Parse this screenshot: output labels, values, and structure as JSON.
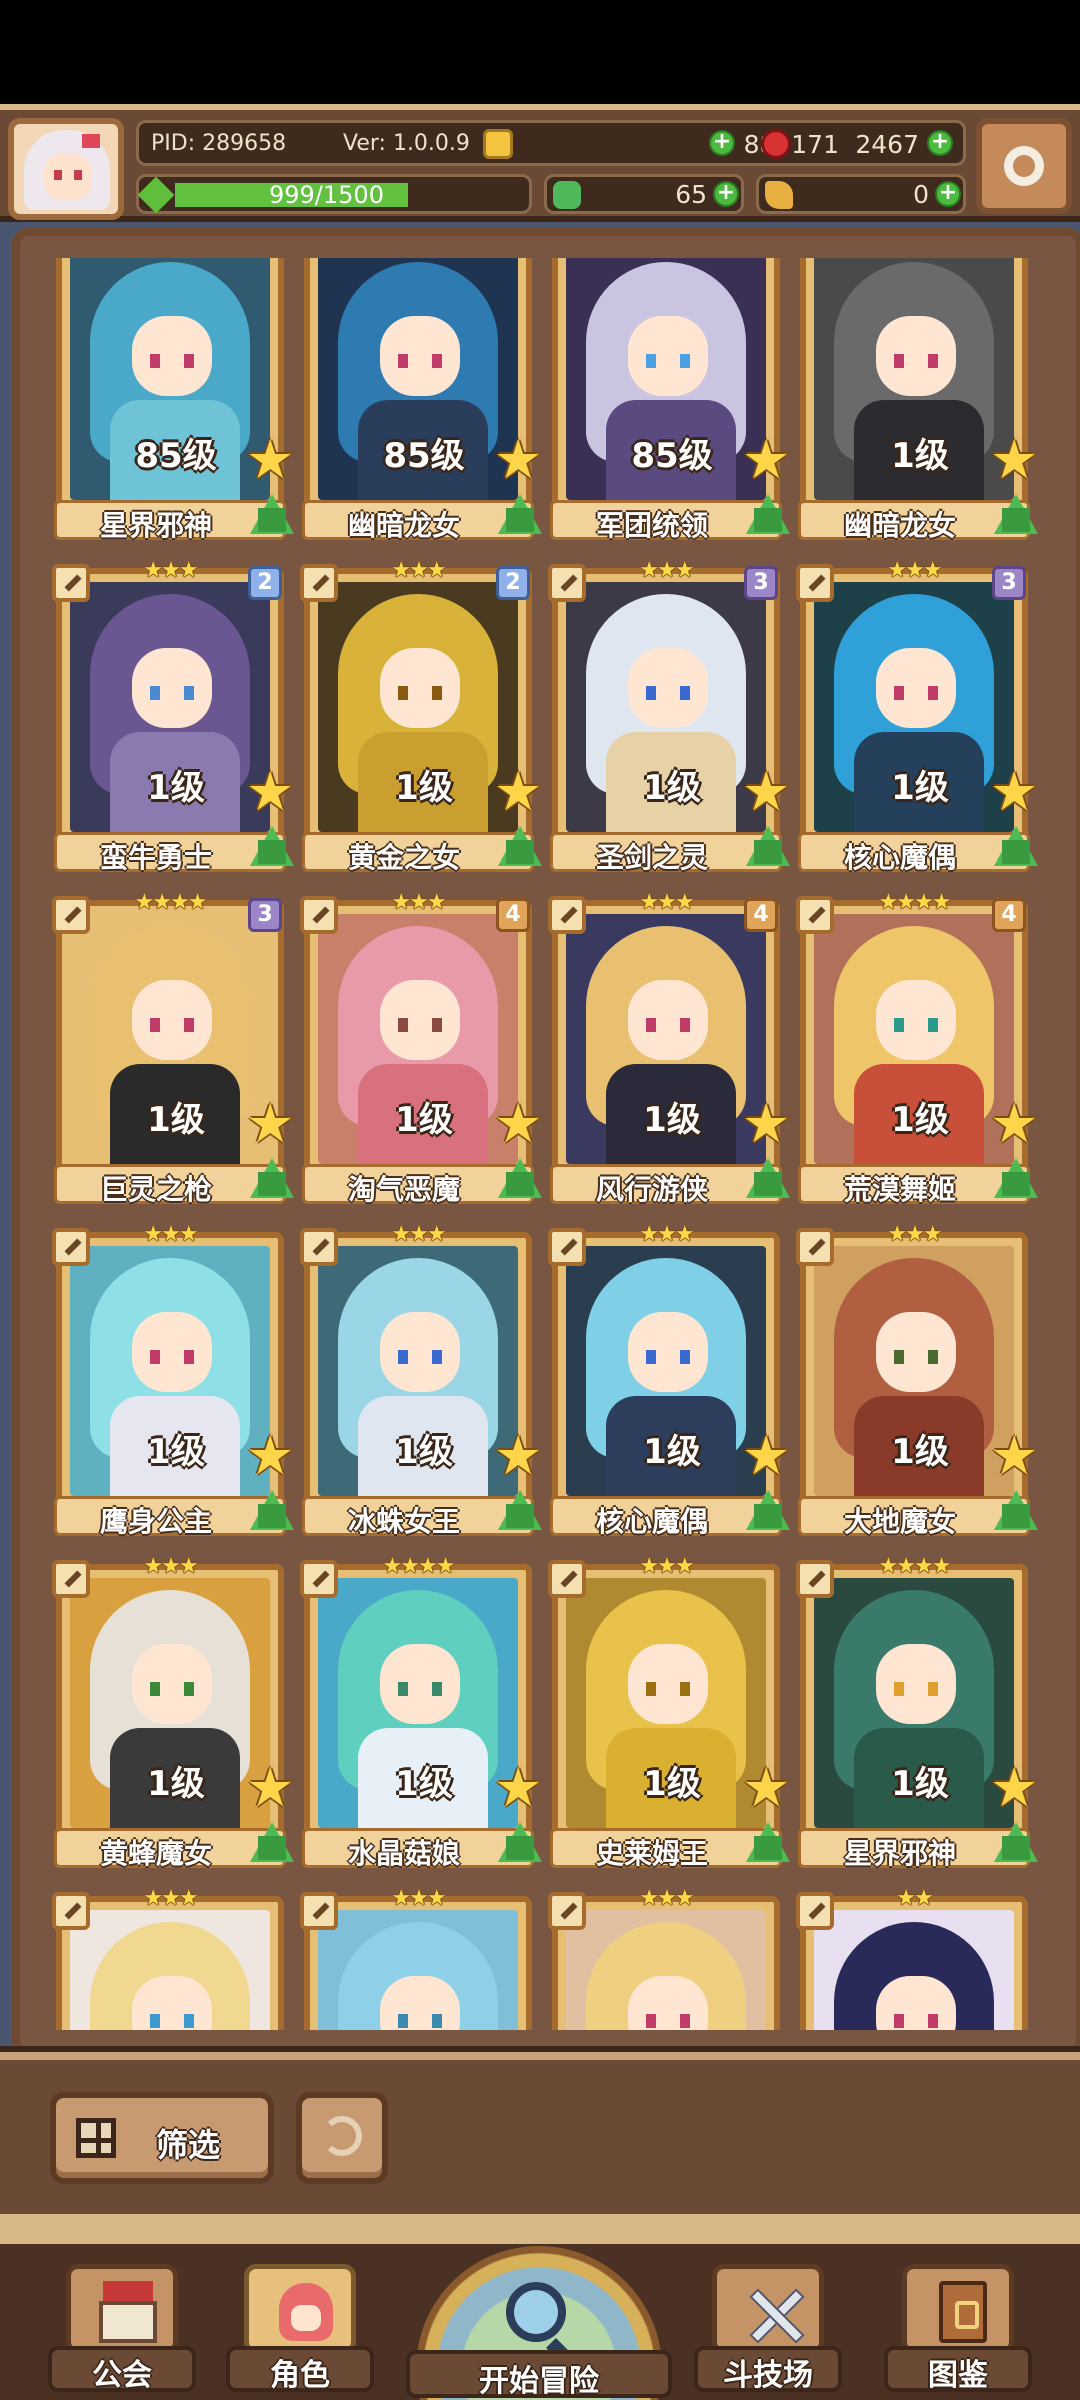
{
  "header": {
    "pid": "PID: 289658",
    "version": "Ver: 1.0.0.9",
    "gold": "886171",
    "gems": "2467",
    "exp_text": "999/1500",
    "exp_progress": 0.666,
    "clover": "65",
    "keys": "0"
  },
  "cards": [
    {
      "name": "星界邪神",
      "level": "85级",
      "stars": "",
      "rank": "",
      "hair": "#4aa9c8",
      "body": "#6fc3d6",
      "eye": "#c23c6a",
      "bg": "#2f5a70"
    },
    {
      "name": "幽暗龙女",
      "level": "85级",
      "stars": "",
      "rank": "",
      "hair": "#2d7bb0",
      "body": "#2a3e5c",
      "eye": "#c23c6a",
      "bg": "#1f3450"
    },
    {
      "name": "军团统领",
      "level": "85级",
      "stars": "",
      "rank": "",
      "hair": "#c9c4e0",
      "body": "#5b4a80",
      "eye": "#4aa0e0",
      "bg": "#3a2f55"
    },
    {
      "name": "幽暗龙女",
      "level": "1级",
      "stars": "",
      "rank": "",
      "hair": "#6a6a6a",
      "body": "#2c2c30",
      "eye": "#c23c6a",
      "bg": "#4a4a4a"
    },
    {
      "name": "蛮牛勇士",
      "level": "1级",
      "stars": "★★★",
      "rank": "2",
      "rank_class": "",
      "hair": "#6a5690",
      "body": "#8a7ab0",
      "eye": "#4a8ad0",
      "bg": "#3a3a5a"
    },
    {
      "name": "黄金之女",
      "level": "1级",
      "stars": "★★★",
      "rank": "2",
      "rank_class": "",
      "hair": "#d9b23a",
      "body": "#c9a030",
      "eye": "#8a5a10",
      "bg": "#4a3a20"
    },
    {
      "name": "圣剑之灵",
      "level": "1级",
      "stars": "★★★",
      "rank": "3",
      "rank_class": "r3",
      "hair": "#dfe6f0",
      "body": "#e6d2a6",
      "eye": "#3a6ad0",
      "bg": "#3c3a46"
    },
    {
      "name": "核心魔偶",
      "level": "1级",
      "stars": "★★★",
      "rank": "3",
      "rank_class": "r3",
      "hair": "#2fa0d8",
      "body": "#24405a",
      "eye": "#c23c6a",
      "bg": "#1e4048"
    },
    {
      "name": "巨灵之枪",
      "level": "1级",
      "stars": "★★★★",
      "rank": "3",
      "rank_class": "r3",
      "hair": "#e8c070",
      "body": "#2a2a2a",
      "eye": "#c23c6a",
      "bg": "#e7bf74"
    },
    {
      "name": "淘气恶魔",
      "level": "1级",
      "stars": "★★★",
      "rank": "4",
      "rank_class": "r4",
      "hair": "#e89aa8",
      "body": "#d9707e",
      "eye": "#8a4a40",
      "bg": "#c8806a"
    },
    {
      "name": "风行游侠",
      "level": "1级",
      "stars": "★★★",
      "rank": "4",
      "rank_class": "r4",
      "hair": "#e8c070",
      "body": "#2a2a3a",
      "eye": "#c23c6a",
      "bg": "#3a3a60"
    },
    {
      "name": "荒漠舞姬",
      "level": "1级",
      "stars": "★★★★",
      "rank": "4",
      "rank_class": "r4",
      "hair": "#efc56a",
      "body": "#c8503a",
      "eye": "#2a9a8a",
      "bg": "#b0705a"
    },
    {
      "name": "鹰身公主",
      "level": "1级",
      "stars": "★★★",
      "rank": "",
      "hair": "#8ee0e6",
      "body": "#e6e6f0",
      "eye": "#c23c6a",
      "bg": "#5fb0c0"
    },
    {
      "name": "冰蛛女王",
      "level": "1级",
      "stars": "★★★",
      "rank": "",
      "hair": "#9ad6e6",
      "body": "#dfe6f0",
      "eye": "#3a6ad0",
      "bg": "#3e6a78"
    },
    {
      "name": "核心魔偶",
      "level": "1级",
      "stars": "★★★",
      "rank": "",
      "hair": "#7fd0e6",
      "body": "#2c3e5c",
      "eye": "#3a6ad0",
      "bg": "#2a3e50"
    },
    {
      "name": "大地魔女",
      "level": "1级",
      "stars": "★★★",
      "rank": "",
      "hair": "#b06040",
      "body": "#8a3a28",
      "eye": "#4a6a30",
      "bg": "#d0a060"
    },
    {
      "name": "黄蜂魔女",
      "level": "1级",
      "stars": "★★★",
      "rank": "",
      "hair": "#e6e0d6",
      "body": "#3a3a3a",
      "eye": "#3a8a3a",
      "bg": "#d9a040"
    },
    {
      "name": "水晶菇娘",
      "level": "1级",
      "stars": "★★★★",
      "rank": "",
      "hair": "#5fcfc0",
      "body": "#e6f0f6",
      "eye": "#3a8a6a",
      "bg": "#4aa8c8"
    },
    {
      "name": "史莱姆王",
      "level": "1级",
      "stars": "★★★",
      "rank": "",
      "hair": "#e8c24a",
      "body": "#d9b030",
      "eye": "#9a7010",
      "bg": "#b08a30"
    },
    {
      "name": "星界邪神",
      "level": "1级",
      "stars": "★★★★",
      "rank": "",
      "hair": "#3a7a6a",
      "body": "#2a5a4a",
      "eye": "#e0a030",
      "bg": "#2a4a40"
    },
    {
      "name": "",
      "level": "",
      "stars": "★★★",
      "rank": "",
      "hair": "#f0d890",
      "body": "#f4f0ec",
      "eye": "#3a9ad0",
      "bg": "#f0e6e0"
    },
    {
      "name": "",
      "level": "",
      "stars": "★★★",
      "rank": "",
      "hair": "#8ed0e8",
      "body": "#9ad6ee",
      "eye": "#3a8ab0",
      "bg": "#7fc0d8"
    },
    {
      "name": "",
      "level": "",
      "stars": "★★★",
      "rank": "",
      "hair": "#f0d080",
      "body": "#f4e6d6",
      "eye": "#c23c6a",
      "bg": "#e0c0a0"
    },
    {
      "name": "",
      "level": "",
      "stars": "★★",
      "rank": "",
      "hair": "#2a2a5a",
      "body": "#5a8a3a",
      "eye": "#c23c6a",
      "bg": "#e8e0f0"
    }
  ],
  "bottom": {
    "filter_label": "筛选"
  },
  "nav": {
    "guild": "公会",
    "character": "角色",
    "adventure": "开始冒险",
    "arena": "斗技场",
    "codex": "图鉴"
  }
}
